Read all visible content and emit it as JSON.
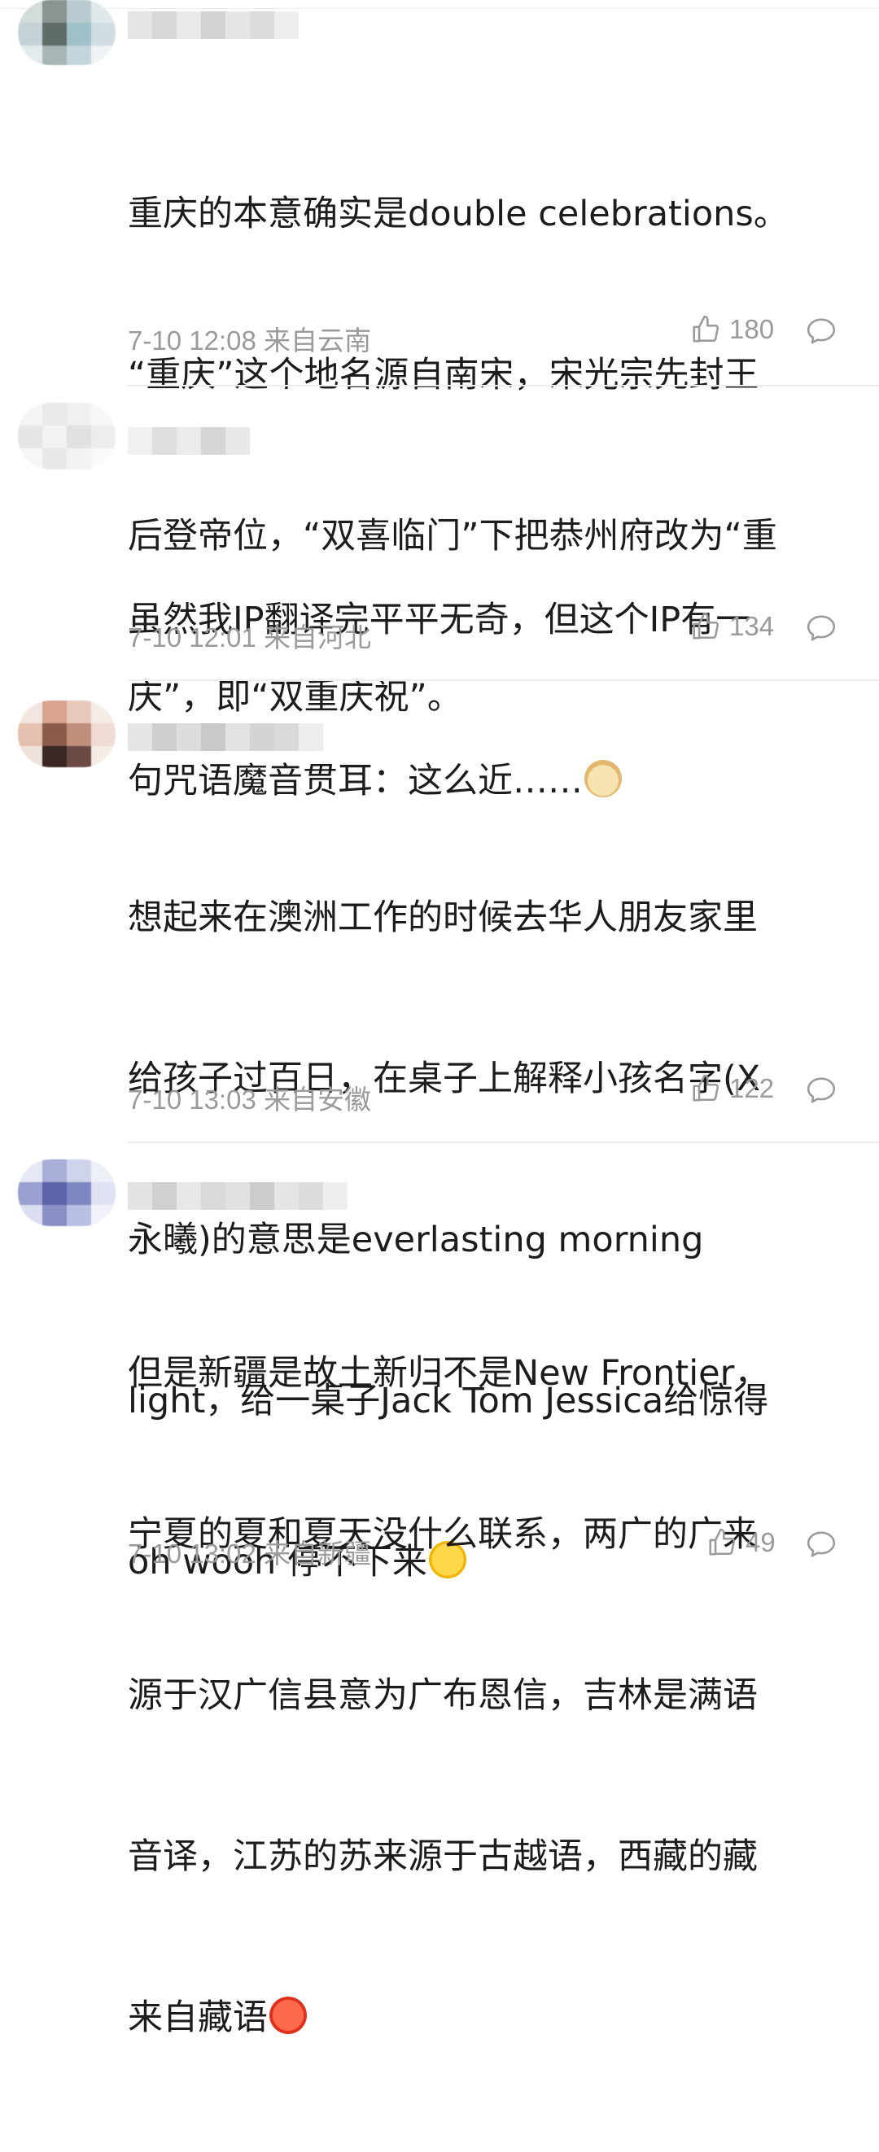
{
  "comments": [
    {
      "text": "重庆的本意确实是double celebrations。\n“重庆”这个地名源自南宋，宋光宗先封王后登帝位，“双喜临门”下把恭州府改为“重庆”，即“双重庆祝”。",
      "lines": [
        "重庆的本意确实是double celebrations。",
        "“重庆”这个地名源自南宋，宋光宗先封王",
        "后登帝位，“双喜临门”下把恭州府改为“重",
        "庆”，即“双重庆祝”。"
      ],
      "emoji": "",
      "time": "7-10 12:08",
      "location": "来自云南",
      "likes": "180",
      "avatar_colors": [
        "#c9d6d4",
        "#7c8a84",
        "#a9c7cf"
      ]
    },
    {
      "lines": [
        "虽然我IP翻译完平平无奇，但这个IP有一",
        "句咒语魔音贯耳：这么近……"
      ],
      "emoji": "doge-emoji",
      "time": "7-10 12:01",
      "location": "来自河北",
      "likes": "134",
      "avatar_colors": [
        "#f1f1f1",
        "#e6e6e6",
        "#ececec"
      ]
    },
    {
      "lines": [
        "想起来在澳洲工作的时候去华人朋友家里",
        "给孩子过百日，在桌子上解释小孩名字(X",
        "永曦)的意思是everlasting morning",
        "light，给一桌子Jack Tom Jessica给惊得",
        "oh wooh 停不下来"
      ],
      "emoji": "laugh-cry-emoji",
      "time": "7-10 13:03",
      "location": "来自安徽",
      "likes": "122",
      "avatar_colors": [
        "#d9b7a3",
        "#5a3a31",
        "#b58a7c"
      ]
    },
    {
      "lines": [
        "但是新疆是故土新归不是New Frontier，",
        "宁夏的夏和夏天没什么联系，两广的广来",
        "源于汉广信县意为广布恩信，吉林是满语",
        "音译，江苏的苏来源于古越语，西藏的藏",
        "来自藏语"
      ],
      "emoji": "angry-emoji",
      "time": "7-10 13:02",
      "location": "来自新疆",
      "likes": "49",
      "avatar_colors": [
        "#8a90c8",
        "#5c63a8",
        "#b7bfe3"
      ]
    }
  ]
}
